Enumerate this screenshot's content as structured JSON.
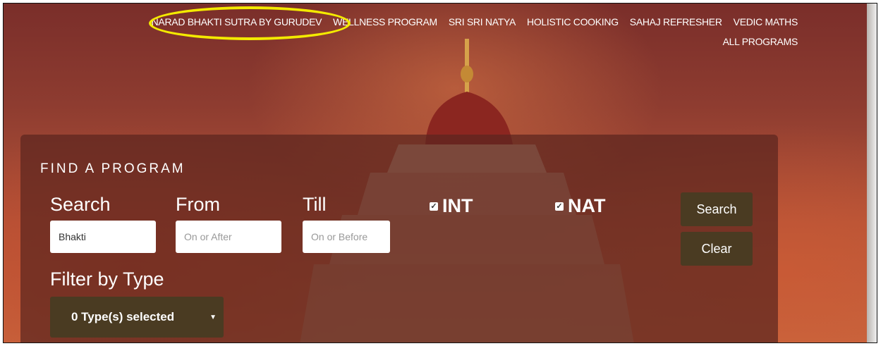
{
  "nav": {
    "row1": [
      "NARAD BHAKTI SUTRA BY GURUDEV",
      "WELLNESS PROGRAM",
      "SRI SRI NATYA",
      "HOLISTIC COOKING",
      "SAHAJ REFRESHER",
      "VEDIC MATHS"
    ],
    "row2": [
      "ALL PROGRAMS"
    ]
  },
  "finder": {
    "title": "FIND A PROGRAM",
    "search_label": "Search",
    "search_value": "Bhakti",
    "from_label": "From",
    "from_placeholder": "On or After",
    "till_label": "Till",
    "till_placeholder": "On or Before",
    "int_label": "INT",
    "int_checked": true,
    "nat_label": "NAT",
    "nat_checked": true,
    "search_button": "Search",
    "clear_button": "Clear",
    "filter_label": "Filter by Type",
    "filter_value": "0 Type(s) selected"
  },
  "colors": {
    "panel": "#5c261e",
    "button": "#4a3b22",
    "highlight": "#f3ea00"
  }
}
